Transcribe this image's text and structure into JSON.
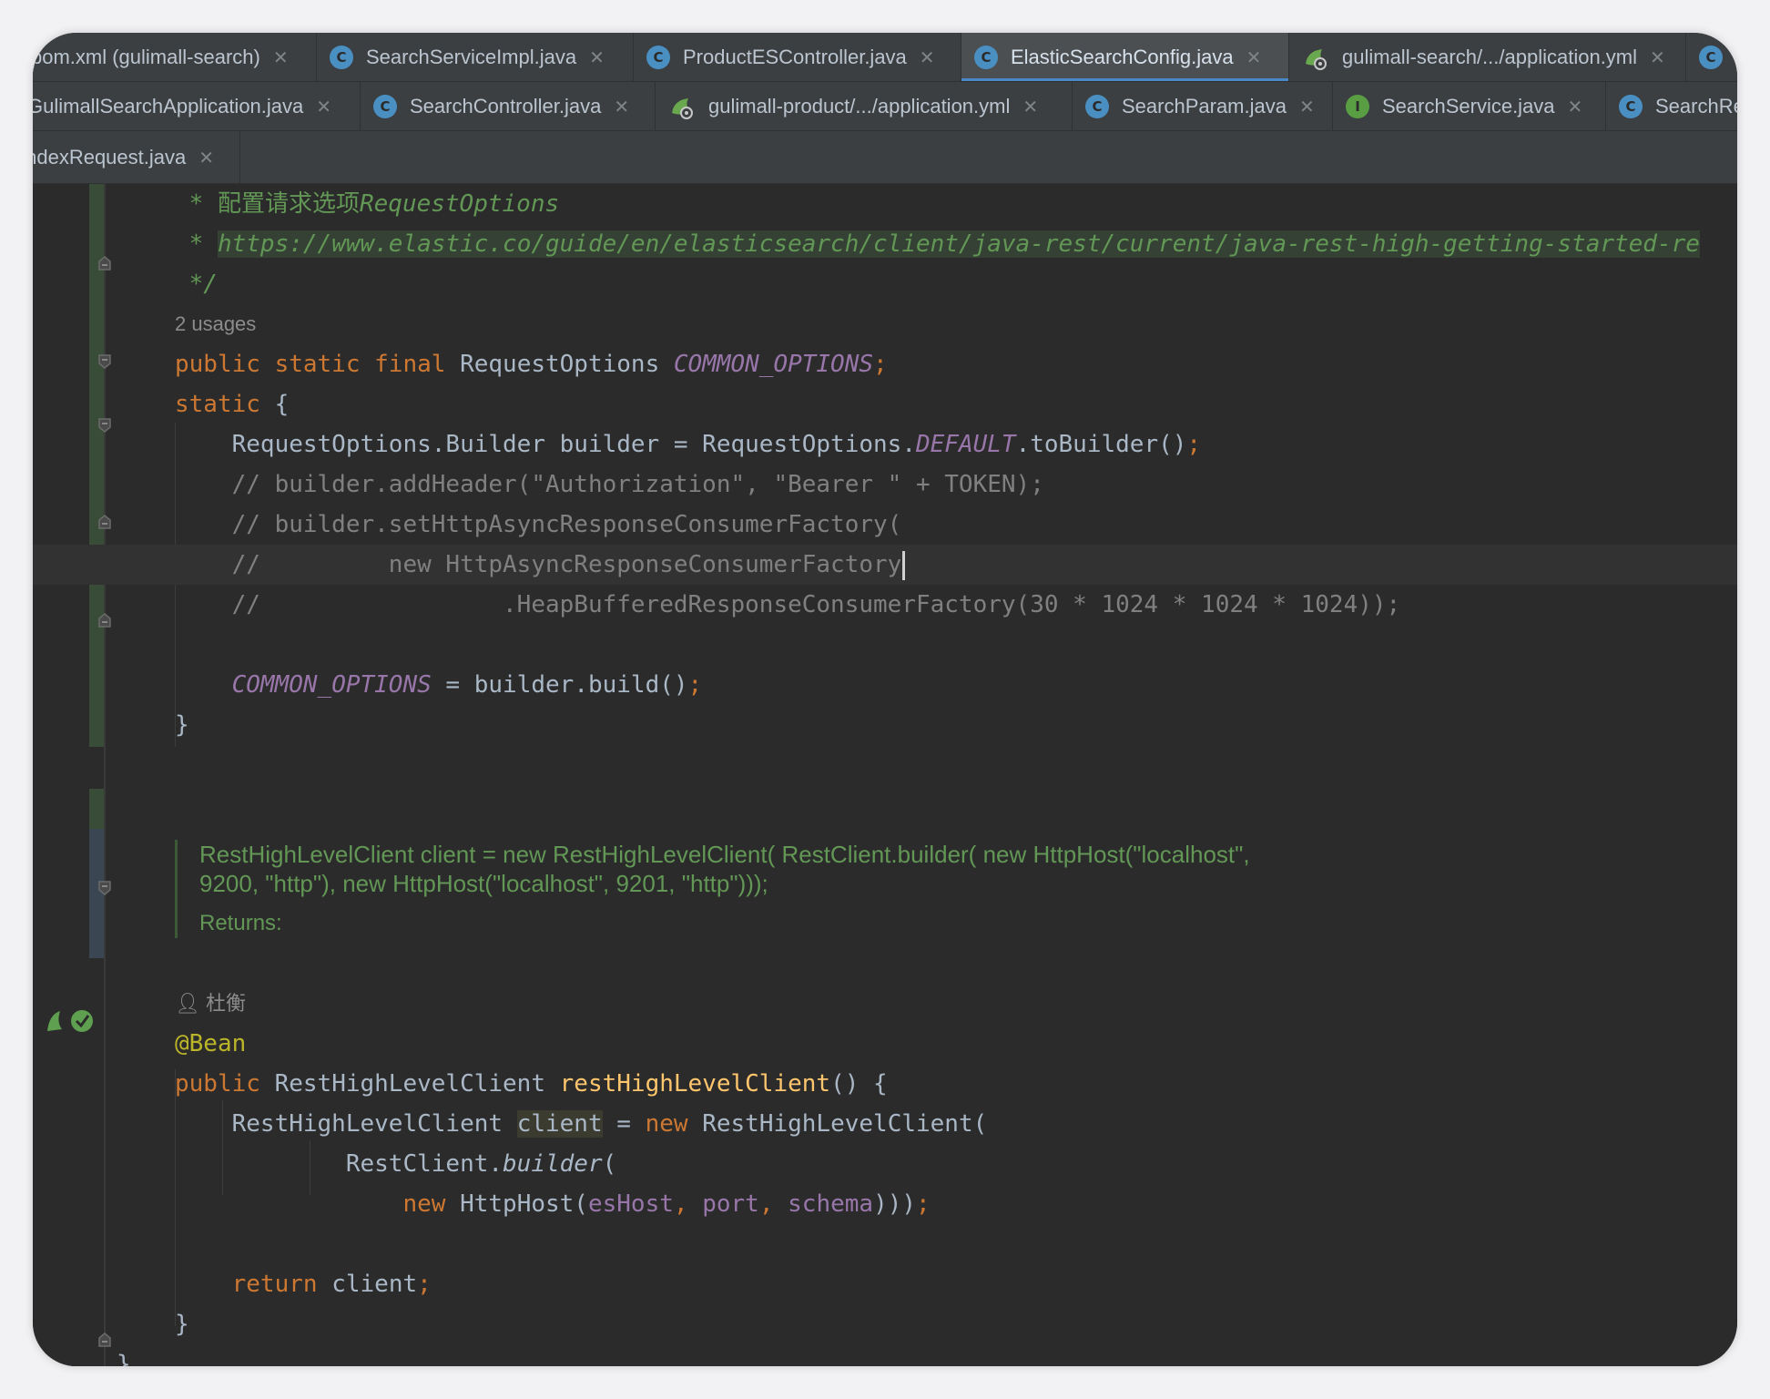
{
  "tabs_row1": [
    {
      "label": "pom.xml (gulimall-search)",
      "icon": "maven-icon",
      "kind": "none"
    },
    {
      "label": "SearchServiceImpl.java",
      "icon": "class-icon",
      "kind": "c"
    },
    {
      "label": "ProductESController.java",
      "icon": "class-icon",
      "kind": "c"
    },
    {
      "label": "ElasticSearchConfig.java",
      "icon": "class-icon",
      "kind": "c",
      "active": true
    },
    {
      "label": "gulimall-search/.../application.yml",
      "icon": "yaml-icon",
      "kind": "y"
    },
    {
      "label": "",
      "icon": "class-icon",
      "kind": "c"
    }
  ],
  "tabs_row2": [
    {
      "label": "GulimallSearchApplication.java",
      "icon": "class-icon",
      "kind": "none"
    },
    {
      "label": "SearchController.java",
      "icon": "class-icon",
      "kind": "c"
    },
    {
      "label": "gulimall-product/.../application.yml",
      "icon": "yaml-icon",
      "kind": "y"
    },
    {
      "label": "SearchParam.java",
      "icon": "class-icon",
      "kind": "c"
    },
    {
      "label": "SearchService.java",
      "icon": "interface-icon",
      "kind": "i"
    },
    {
      "label": "SearchRe",
      "icon": "class-icon",
      "kind": "c"
    }
  ],
  "tabs_row3": [
    {
      "label": "IndexRequest.java",
      "icon": "class-icon",
      "kind": "none"
    }
  ],
  "code": {
    "l1_prefix": " * ",
    "l1_text": "配置请求选项",
    "l1_ital": "RequestOptions",
    "l2_prefix": " * ",
    "l2_url": "https://www.elastic.co/guide/en/elasticsearch/client/java-rest/current/java-rest-high-getting-started-re",
    "l3": " */",
    "usages": "2 usages",
    "l5_kw": "public static final",
    "l5_type": " RequestOptions ",
    "l5_field": "COMMON_OPTIONS",
    "l5_end": ";",
    "l6_kw": "static",
    "l6_rest": " {",
    "l7_a": "    RequestOptions.Builder builder = RequestOptions.",
    "l7_field": "DEFAULT",
    "l7_b": ".toBuilder()",
    "l7_end": ";",
    "l8": "    // builder.addHeader(\"Authorization\", \"Bearer \" + TOKEN);",
    "l9": "    // builder.setHttpAsyncResponseConsumerFactory(",
    "l10": "    //         new HttpAsyncResponseConsumerFactory",
    "l11": "    //                 .HeapBufferedResponseConsumerFactory(30 * 1024 * 1024 * 1024));",
    "l13_field": "COMMON_OPTIONS",
    "l13_rest": " = builder.build()",
    "l13_end": ";",
    "l14": "}",
    "doc_line1": "RestHighLevelClient client = new RestHighLevelClient( RestClient.builder( new HttpHost(\"localhost\",",
    "doc_line2": "9200, \"http\"), new HttpHost(\"localhost\", 9201, \"http\")));",
    "doc_returns": "Returns:",
    "author": "杜衡",
    "annotation": "@Bean",
    "m1_kw": "public",
    "m1_type": " RestHighLevelClient ",
    "m1_fn": "restHighLevelClient",
    "m1_rest": "() {",
    "m2_a": "    RestHighLevelClient ",
    "m2_var": "client",
    "m2_b": " = ",
    "m2_kw": "new",
    "m2_c": " RestHighLevelClient(",
    "m3_a": "            RestClient.",
    "m3_fn": "builder",
    "m3_b": "(",
    "m4_kw": "new",
    "m4_a": " HttpHost(",
    "m4_p1": "esHost",
    "m4_s1": ", ",
    "m4_p2": "port",
    "m4_s2": ", ",
    "m4_p3": "schema",
    "m4_b": ")))",
    "m4_end": ";",
    "m6_kw": "return",
    "m6_rest": " client",
    "m6_end": ";",
    "m7": "}",
    "m8": "}"
  }
}
